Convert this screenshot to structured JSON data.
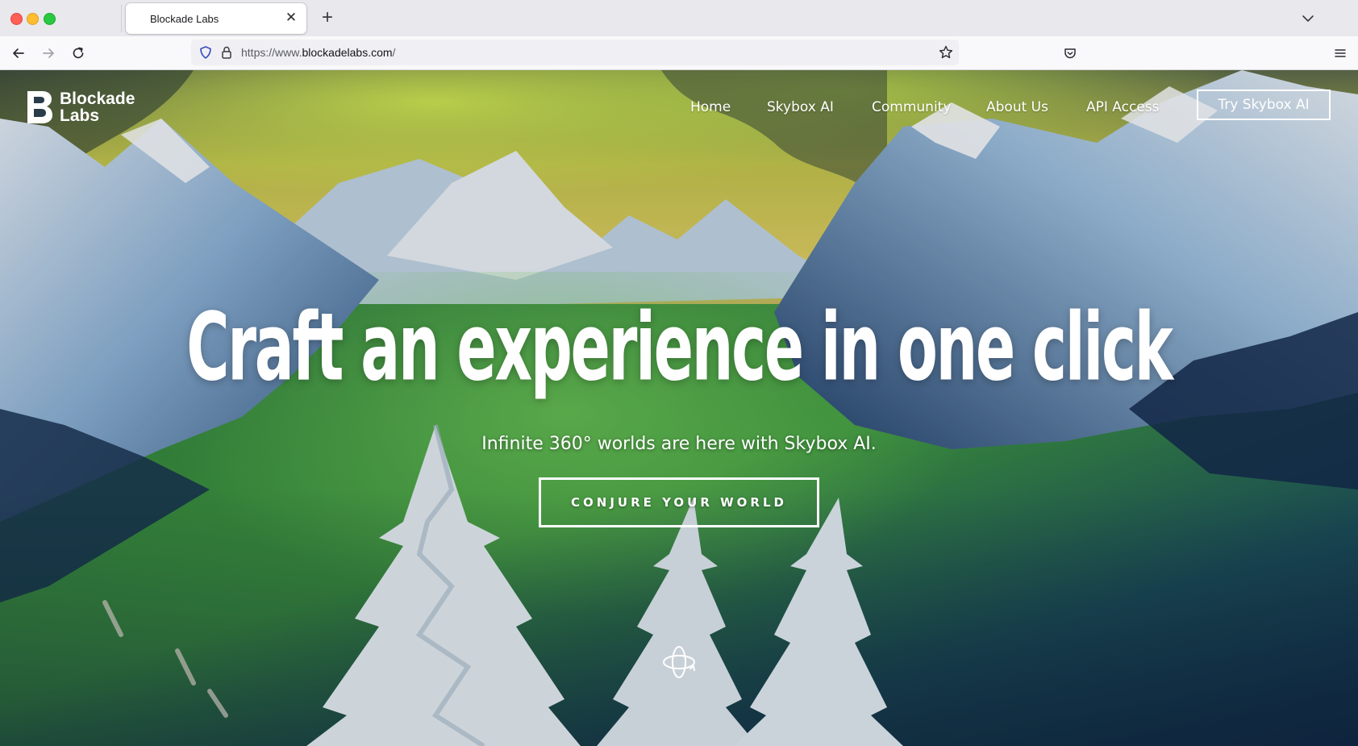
{
  "browser": {
    "tab_title": "Blockade Labs",
    "tab_close_glyph": "✕",
    "new_tab_glyph": "+",
    "url_prefix": "https://www.",
    "url_domain": "blockadelabs.com",
    "url_suffix": "/"
  },
  "site": {
    "logo_line1": "Blockade",
    "logo_line2": "Labs",
    "nav": {
      "home": "Home",
      "skybox": "Skybox AI",
      "community": "Community",
      "about": "About Us",
      "api": "API Access"
    },
    "try_button": "Try Skybox AI"
  },
  "hero": {
    "headline": "Craft an experience in one click",
    "subhead": "Infinite 360° worlds are here with Skybox AI.",
    "cta": "CONJURE YOUR WORLD"
  },
  "icons": {
    "back": "arrow-left-icon",
    "forward": "arrow-right-icon",
    "reload": "reload-icon",
    "shield": "shield-icon",
    "lock": "lock-icon",
    "bookmark": "star-icon",
    "pocket": "pocket-icon",
    "menu": "hamburger-icon",
    "scroll": "orbit-360-icon"
  },
  "colors": {
    "accent_text": "#ffffff",
    "tab_strip": "#e8e8ed",
    "url_field": "#f0f0f4"
  }
}
